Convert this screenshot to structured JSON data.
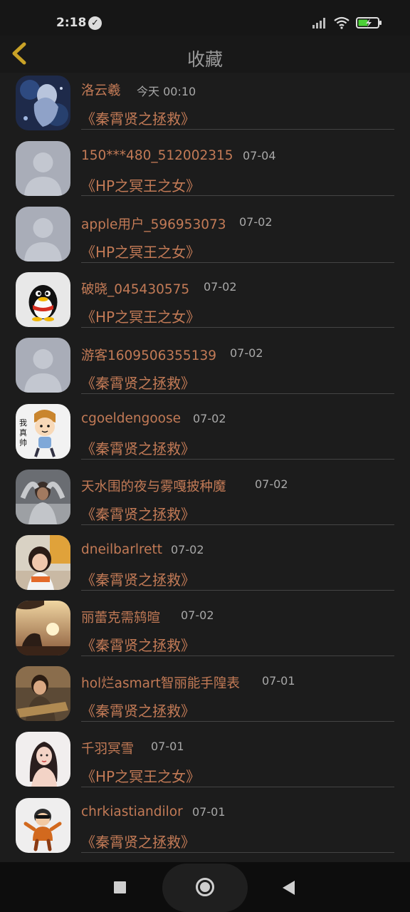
{
  "status_bar": {
    "time": "2:18"
  },
  "header": {
    "title": "收藏"
  },
  "items": [
    {
      "name": "洛云羲",
      "time": "今天 00:10",
      "book": "《秦霄贤之拯救》"
    },
    {
      "name": "150***480_512002315",
      "time": "07-04",
      "book": "《HP之冥王之女》"
    },
    {
      "name": "apple用户_596953073",
      "time": "07-02",
      "book": "《HP之冥王之女》"
    },
    {
      "name": "破晓_045430575",
      "time": "07-02",
      "book": "《HP之冥王之女》"
    },
    {
      "name": "游客1609506355139",
      "time": "07-02",
      "book": "《秦霄贤之拯救》"
    },
    {
      "name": "cgoeldengoose",
      "time": "07-02",
      "book": "《秦霄贤之拯救》"
    },
    {
      "name": "天水围的夜与雾嘎披种魔",
      "time": "07-02",
      "book": "《秦霄贤之拯救》"
    },
    {
      "name": "dneilbarlrett",
      "time": "07-02",
      "book": "《秦霄贤之拯救》"
    },
    {
      "name": "丽蕾克需鸫暄",
      "time": "07-02",
      "book": "《秦霄贤之拯救》"
    },
    {
      "name": "hol烂asmart智丽能手隍表",
      "time": "07-01",
      "book": "《秦霄贤之拯救》"
    },
    {
      "name": "千羽冥雪",
      "time": "07-01",
      "book": "《HP之冥王之女》"
    },
    {
      "name": "chrkiastiandilor",
      "time": "07-01",
      "book": "《秦霄贤之拯救》"
    }
  ]
}
